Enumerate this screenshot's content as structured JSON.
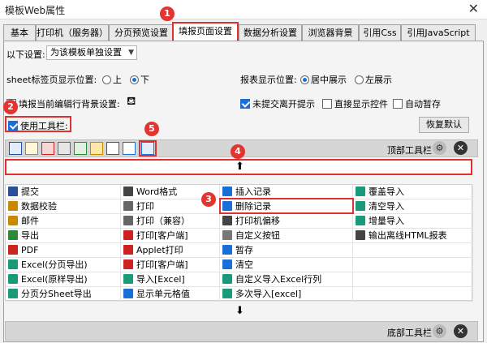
{
  "window": {
    "title": "模板Web属性",
    "close": "✕"
  },
  "tabs": [
    "基本",
    "打印机（服务器）",
    "分页预览设置",
    "填报页面设置",
    "数据分析设置",
    "浏览器背景",
    "引用Css",
    "引用JavaScript"
  ],
  "badges": {
    "b1": "1",
    "b2": "2",
    "b3": "3",
    "b4": "4",
    "b5": "5"
  },
  "settings": {
    "following_label": "以下设置:",
    "following_value": "为该模板单独设置",
    "sheet_pos_label": "sheet标签页显示位置:",
    "sheet_top": "上",
    "sheet_bottom": "下",
    "report_pos_label": "报表显示位置:",
    "report_center": "居中展示",
    "report_left": "左展示",
    "fill_bg_label": "填报当前编辑行背景设置:",
    "unsubmitted": "未提交离开提示",
    "direct_show": "直接显示控件",
    "auto_save": "自动暂存",
    "use_toolbar": "使用工具栏:",
    "restore": "恢复默认"
  },
  "top_toolbar_label": "顶部工具栏",
  "bottom_toolbar_label": "底部工具栏",
  "grid": [
    [
      "提交",
      "Word格式",
      "插入记录",
      "覆盖导入"
    ],
    [
      "数据校验",
      "打印",
      "删除记录",
      "清空导入"
    ],
    [
      "邮件",
      "打印（兼容）",
      "打印机偏移",
      "增量导入"
    ],
    [
      "导出",
      "打印[客户端]",
      "自定义按钮",
      "输出离线HTML报表"
    ],
    [
      "PDF",
      "Applet打印",
      "暂存",
      ""
    ],
    [
      "Excel(分页导出)",
      "打印[客户端]",
      "清空",
      ""
    ],
    [
      "Excel(原样导出)",
      "导入[Excel]",
      "自定义导入Excel行列",
      ""
    ],
    [
      "分页分Sheet导出",
      "显示单元格值",
      "多次导入[excel]",
      ""
    ]
  ],
  "colors": {
    "accent": "#e0302f",
    "selected": "#1a6fd6"
  }
}
